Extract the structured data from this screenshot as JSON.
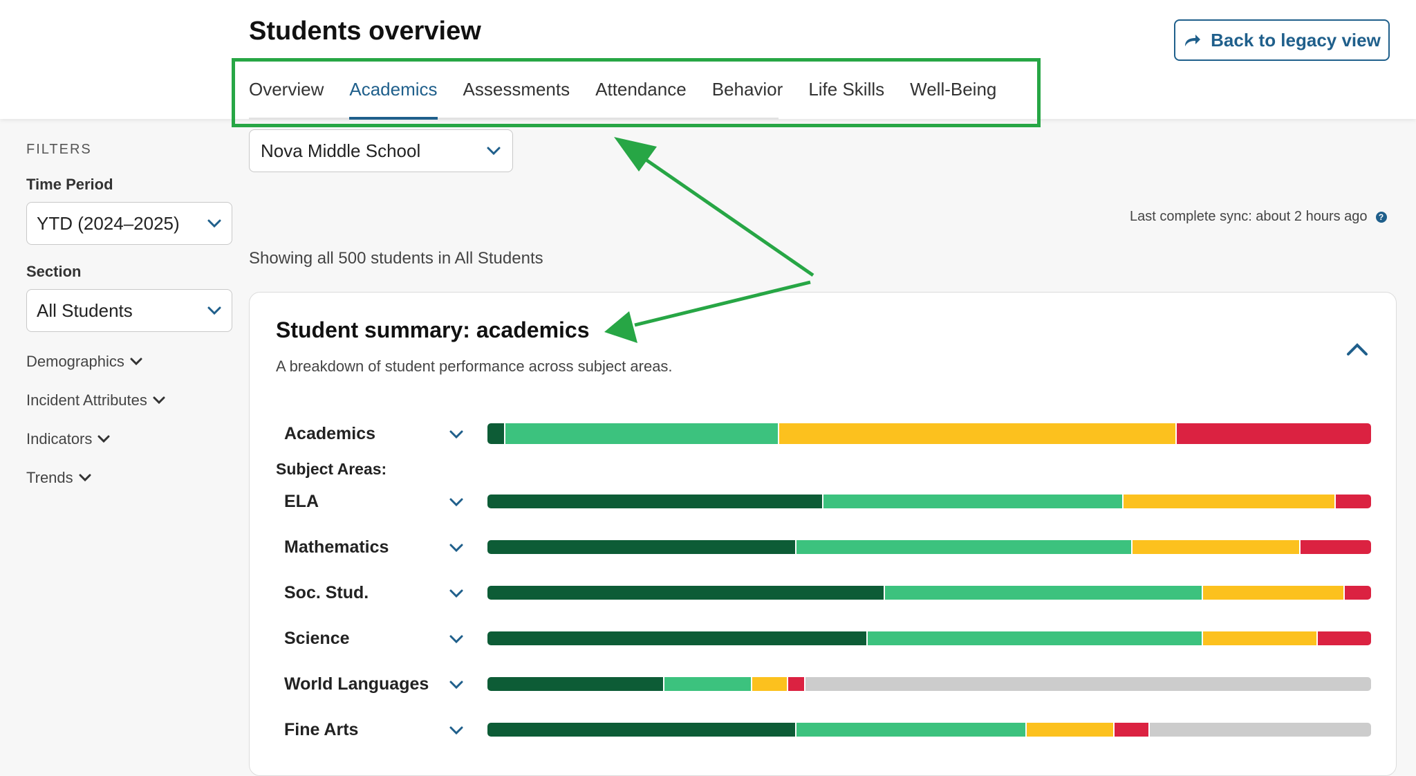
{
  "header": {
    "title": "Students overview",
    "legacy_button": "Back to legacy view"
  },
  "tabs": [
    {
      "label": "Overview",
      "active": false
    },
    {
      "label": "Academics",
      "active": true
    },
    {
      "label": "Assessments",
      "active": false
    },
    {
      "label": "Attendance",
      "active": false
    },
    {
      "label": "Behavior",
      "active": false
    },
    {
      "label": "Life Skills",
      "active": false
    },
    {
      "label": "Well-Being",
      "active": false
    }
  ],
  "school_select": {
    "value": "Nova Middle School"
  },
  "sidebar": {
    "title": "FILTERS",
    "time_period_label": "Time Period",
    "time_period_value": "YTD (2024–2025)",
    "section_label": "Section",
    "section_value": "All Students",
    "links": [
      "Demographics",
      "Incident Attributes",
      "Indicators",
      "Trends"
    ]
  },
  "sync": {
    "text": "Last complete sync: about 2 hours ago"
  },
  "showing": "Showing all 500 students in All Students",
  "card": {
    "title": "Student summary: academics",
    "subtitle": "A breakdown of student performance across subject areas.",
    "subject_heading": "Subject Areas:"
  },
  "colors": {
    "dark_green": "#0d5c36",
    "green": "#3cc27e",
    "yellow": "#fcc11e",
    "red": "#db2241",
    "gray": "#cccccc",
    "accent": "#1f5f8b",
    "annotation": "#27a645"
  },
  "chart_data": {
    "type": "bar",
    "stacked": true,
    "categories": [
      "Academics",
      "ELA",
      "Mathematics",
      "Soc. Stud.",
      "Science",
      "World Languages",
      "Fine Arts"
    ],
    "series": [
      {
        "values": [
          2,
          38,
          35,
          45,
          43,
          20,
          35
        ]
      },
      {
        "values": [
          31,
          34,
          38,
          36,
          38,
          10,
          26
        ]
      },
      {
        "values": [
          45,
          24,
          19,
          16,
          13,
          4,
          10
        ]
      },
      {
        "values": [
          22,
          4,
          8,
          3,
          6,
          2,
          4
        ]
      },
      {
        "values": [
          0,
          0,
          0,
          0,
          0,
          64,
          25
        ]
      }
    ]
  }
}
